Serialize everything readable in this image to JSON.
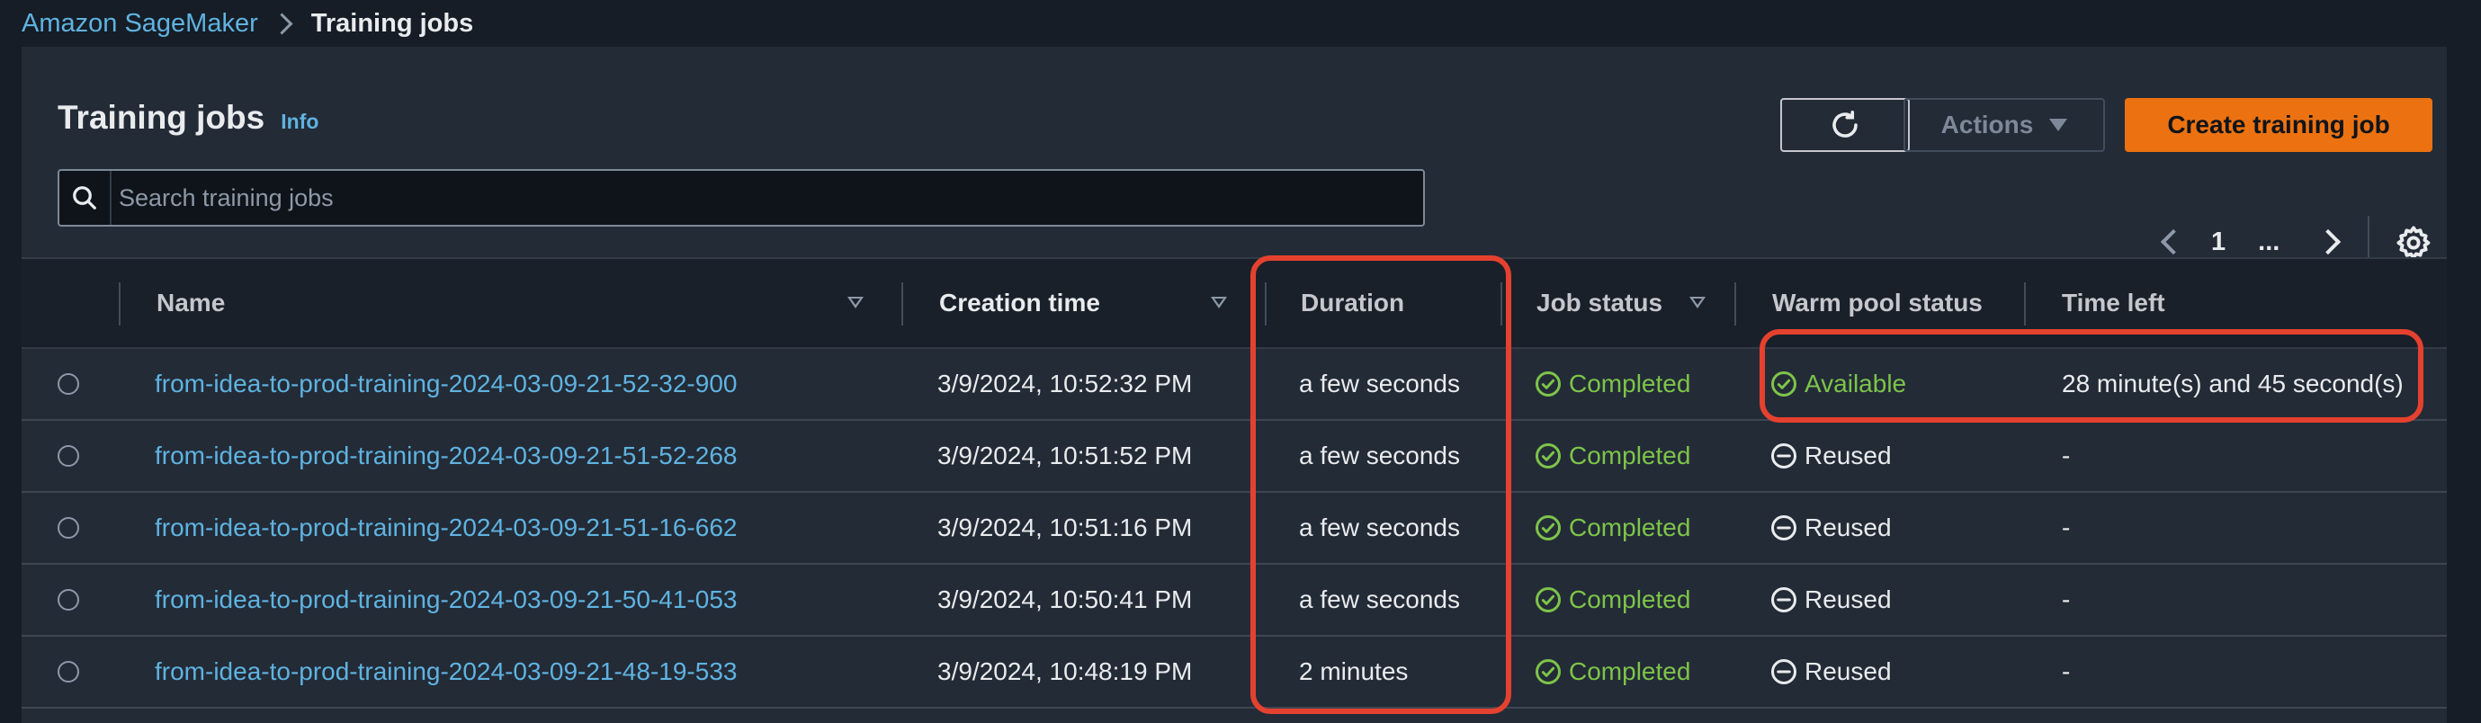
{
  "breadcrumb": {
    "root": "Amazon SageMaker",
    "current": "Training jobs"
  },
  "header": {
    "title": "Training jobs",
    "info": "Info",
    "actions_label": "Actions",
    "create_label": "Create training job"
  },
  "search": {
    "placeholder": "Search training jobs",
    "value": ""
  },
  "pagination": {
    "current_page": "1",
    "ellipsis": "..."
  },
  "table": {
    "columns": [
      "Name",
      "Creation time",
      "Duration",
      "Job status",
      "Warm pool status",
      "Time left"
    ],
    "rows": [
      {
        "name": "from-idea-to-prod-training-2024-03-09-21-52-32-900",
        "creation_time": "3/9/2024, 10:52:32 PM",
        "duration": "a few seconds",
        "job_status": "Completed",
        "warm_pool_status": "Available",
        "time_left": "28 minute(s) and 45 second(s)"
      },
      {
        "name": "from-idea-to-prod-training-2024-03-09-21-51-52-268",
        "creation_time": "3/9/2024, 10:51:52 PM",
        "duration": "a few seconds",
        "job_status": "Completed",
        "warm_pool_status": "Reused",
        "time_left": "-"
      },
      {
        "name": "from-idea-to-prod-training-2024-03-09-21-51-16-662",
        "creation_time": "3/9/2024, 10:51:16 PM",
        "duration": "a few seconds",
        "job_status": "Completed",
        "warm_pool_status": "Reused",
        "time_left": "-"
      },
      {
        "name": "from-idea-to-prod-training-2024-03-09-21-50-41-053",
        "creation_time": "3/9/2024, 10:50:41 PM",
        "duration": "a few seconds",
        "job_status": "Completed",
        "warm_pool_status": "Reused",
        "time_left": "-"
      },
      {
        "name": "from-idea-to-prod-training-2024-03-09-21-48-19-533",
        "creation_time": "3/9/2024, 10:48:19 PM",
        "duration": "2 minutes",
        "job_status": "Completed",
        "warm_pool_status": "Reused",
        "time_left": "-"
      }
    ]
  },
  "colors": {
    "accent_orange": "#ec7211",
    "link_blue": "#5fb3e0",
    "success_green": "#7dc449",
    "highlight_red": "#e5412f"
  },
  "icons": {
    "search": "search-icon",
    "refresh": "refresh-icon",
    "settings": "gear-icon",
    "completed": "check-circle-icon",
    "reused": "minus-circle-icon"
  }
}
